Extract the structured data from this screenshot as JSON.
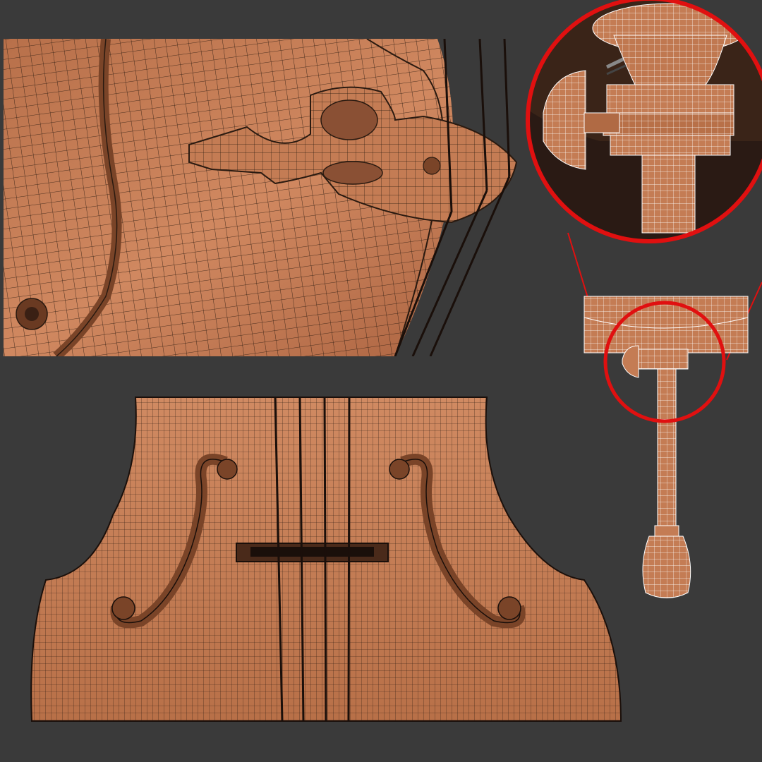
{
  "colors": {
    "background": "#3a3a3a",
    "wood_light": "#d8906a",
    "wood_mid": "#c07850",
    "wood_dark": "#8a5034",
    "wireframe": "#1a0f0a",
    "highlight_ring": "#e01010"
  }
}
